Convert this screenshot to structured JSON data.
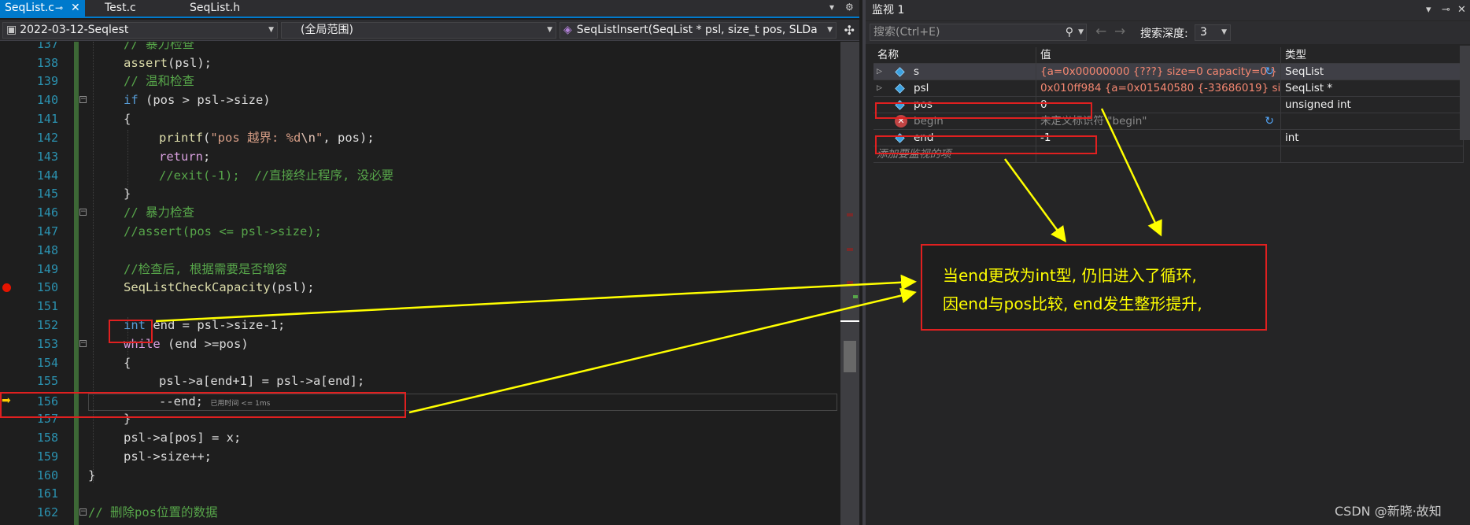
{
  "editor": {
    "tabs": [
      {
        "label": "SeqList.c",
        "pin": "⊸",
        "close": "✕"
      },
      {
        "label": "Test.c"
      },
      {
        "label": "SeqList.h"
      }
    ],
    "tabbar_controls": {
      "dropdown": "▾",
      "settings": "⚙"
    },
    "nav": {
      "project": "2022-03-12-Seqlest",
      "scope": "(全局范围)",
      "function": "SeqListInsert(SeqList * psl, size_t pos, SLDa"
    },
    "lines": [
      {
        "num": "137",
        "text": "// 暴力检查"
      },
      {
        "num": "138",
        "fn": "assert",
        "rest": "(psl);"
      },
      {
        "num": "139",
        "text": "// 温和检查"
      },
      {
        "num": "140",
        "kw": "if",
        "rest": " (pos > psl->size)"
      },
      {
        "num": "141",
        "text": "{"
      },
      {
        "num": "142",
        "fn": "printf",
        "str1": "\"pos 越界: %d",
        "esc": "\\n",
        "str2": "\"",
        "rest": ", pos);"
      },
      {
        "num": "143",
        "kw": "return",
        "rest": ";"
      },
      {
        "num": "144",
        "text": "//exit(-1);  //直接终止程序, 没必要"
      },
      {
        "num": "145",
        "text": "}"
      },
      {
        "num": "146",
        "text": "// 暴力检查"
      },
      {
        "num": "147",
        "text": "//assert(pos <= psl->size);"
      },
      {
        "num": "148",
        "text": ""
      },
      {
        "num": "149",
        "text": "//检查后, 根据需要是否增容"
      },
      {
        "num": "150",
        "fn": "SeqListCheckCapacity",
        "rest": "(psl);"
      },
      {
        "num": "151",
        "text": ""
      },
      {
        "num": "152",
        "kw": "int",
        "rest": " end = psl->size-1;"
      },
      {
        "num": "153",
        "kw": "while",
        "rest": " (end >=pos)"
      },
      {
        "num": "154",
        "text": "{"
      },
      {
        "num": "155",
        "text": "psl->a[end+1] = psl->a[end];"
      },
      {
        "num": "156",
        "text": "--end;",
        "tip": "已用时间 <= 1ms"
      },
      {
        "num": "157",
        "text": "}"
      },
      {
        "num": "158",
        "text": "psl->a[pos] = x;"
      },
      {
        "num": "159",
        "text": "psl->size++;"
      },
      {
        "num": "160",
        "text": "}"
      },
      {
        "num": "161",
        "text": ""
      },
      {
        "num": "162",
        "text": "// 删除pos位置的数据"
      }
    ]
  },
  "watch": {
    "title": "监视 1",
    "title_controls": {
      "dropdown": "▾",
      "pin": "⊸",
      "close": "✕"
    },
    "search_placeholder": "搜索(Ctrl+E)",
    "search_icon": "search-icon",
    "back_arrow": "←",
    "forward_arrow": "→",
    "depth_label": "搜索深度:",
    "depth_value": "3",
    "columns": {
      "name": "名称",
      "value": "值",
      "type": "类型"
    },
    "rows": [
      {
        "name": "s",
        "value": "{a=0x00000000 {???} size=0 capacity=0 }",
        "type": "SeqList",
        "expandable": "▷"
      },
      {
        "name": "psl",
        "value": "0x010ff984 {a=0x01540580 {-33686019} size=0 capac...",
        "type": "SeqList *",
        "expandable": "▷"
      },
      {
        "name": "pos",
        "value": "0",
        "type": "unsigned int"
      },
      {
        "name": "begin",
        "value": "未定义标识符 \"begin\"",
        "type": "",
        "error": "✕"
      },
      {
        "name": "end",
        "value": "-1",
        "type": "int"
      }
    ],
    "add_item": "添加要监视的项",
    "refresh_glyph": "↻"
  },
  "callout": {
    "line1": "当end更改为int型, 仍旧进入了循环,",
    "line2": "因end与pos比较, end发生整形提升,"
  },
  "watermark": "CSDN @新晓·故知",
  "colors": {
    "annotation_red": "#e02020",
    "annotation_yellow": "#ffff00",
    "accent": "#007acc"
  }
}
